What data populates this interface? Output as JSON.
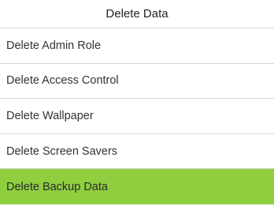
{
  "header": {
    "title": "Delete Data"
  },
  "menu": {
    "items": [
      {
        "label": "Delete Admin Role"
      },
      {
        "label": "Delete Access Control"
      },
      {
        "label": "Delete Wallpaper"
      },
      {
        "label": "Delete Screen Savers"
      },
      {
        "label": "Delete Backup Data"
      }
    ],
    "selected_label": "Delete Backup Data"
  },
  "colors": {
    "selected_background": "#8fce3f",
    "divider": "#d6d6d6",
    "background": "#ffffff"
  }
}
